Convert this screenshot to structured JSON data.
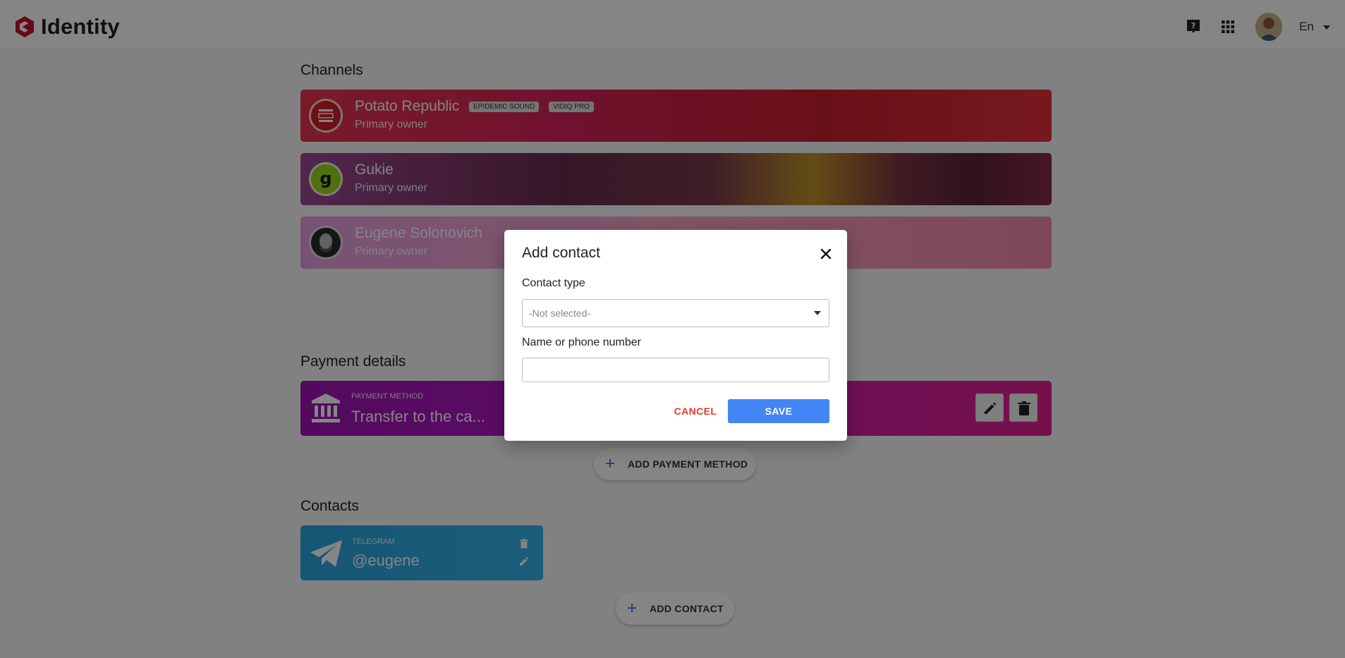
{
  "app": {
    "title": "Identity",
    "language": "En"
  },
  "header": {
    "help_icon": "help-icon",
    "apps_icon": "apps-grid-icon",
    "avatar": "user-avatar"
  },
  "channels": {
    "title": "Channels",
    "items": [
      {
        "name": "Potato Republic",
        "role": "Primary owner",
        "badges": [
          "EPIDEMIC SOUND",
          "VIDIQ PRO"
        ],
        "color": "#e8344e"
      },
      {
        "name": "Gukie",
        "role": "Primary owner",
        "badges": [],
        "color": "#6b2b4e"
      },
      {
        "name": "Eugene Solonovich",
        "role": "Primary owner",
        "badges": [],
        "color": "#f48aa8"
      }
    ]
  },
  "payment": {
    "title": "Payment details",
    "method_label": "PAYMENT METHOD",
    "method_value": "Transfer to the ca...",
    "add_label": "ADD PAYMENT METHOD"
  },
  "contacts": {
    "title": "Contacts",
    "items": [
      {
        "type": "TELEGRAM",
        "value": "@eugene"
      }
    ],
    "add_label": "ADD CONTACT"
  },
  "dialog": {
    "title": "Add contact",
    "contact_type_label": "Contact type",
    "contact_type_value": "-Not selected-",
    "name_label": "Name or phone number",
    "name_value": "",
    "cancel_label": "CANCEL",
    "save_label": "SAVE"
  },
  "colors": {
    "accent": "#4285f4",
    "cancel": "#e53b2c",
    "brand": "#c8102e",
    "payment_gradient_start": "#9e13b5",
    "telegram": "#2aa6df"
  }
}
